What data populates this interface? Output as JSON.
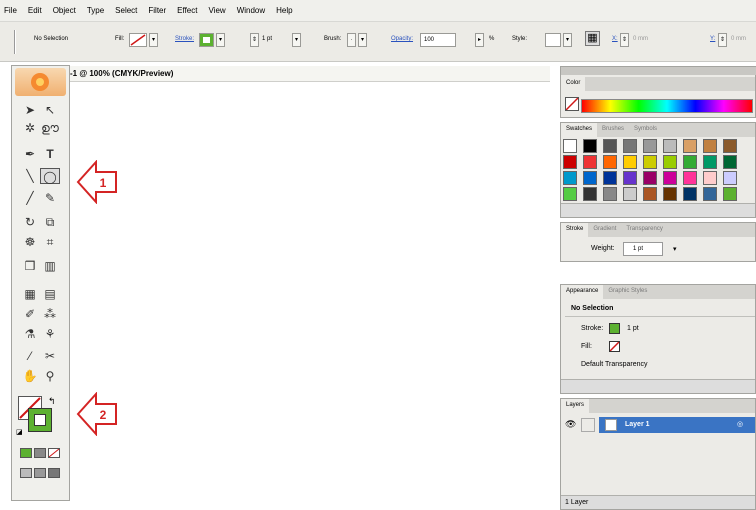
{
  "menu": [
    "File",
    "Edit",
    "Object",
    "Type",
    "Select",
    "Filter",
    "Effect",
    "View",
    "Window",
    "Help"
  ],
  "control_bar": {
    "selection": "No Selection",
    "fill_label": "Fill:",
    "stroke_label": "Stroke:",
    "stroke_weight": "1 pt",
    "brush_label": "Brush:",
    "opacity_label": "Opacity:",
    "opacity_value": "100",
    "opacity_unit": "%",
    "style_label": "Style:",
    "x_label": "X:",
    "x_value": "0 mm",
    "y_label": "Y:",
    "y_value": "0 mm"
  },
  "document": {
    "tab_title": "-1 @ 100% (CMYK/Preview)"
  },
  "callouts": {
    "one": "1",
    "two": "2"
  },
  "color_panel": {
    "title": "Color"
  },
  "swatches_panel": {
    "tabs": [
      "Swatches",
      "Brushes",
      "Symbols"
    ]
  },
  "stroke_panel": {
    "tabs": [
      "Stroke",
      "Gradient",
      "Transparency"
    ],
    "weight_label": "Weight:",
    "weight_value": "1 pt"
  },
  "appearance_panel": {
    "tabs": [
      "Appearance",
      "Graphic Styles"
    ],
    "header": "No Selection",
    "stroke_label": "Stroke:",
    "stroke_value": "1 pt",
    "fill_label": "Fill:",
    "default_transparency": "Default Transparency"
  },
  "layers_panel": {
    "tab": "Layers",
    "layer_name": "Layer 1",
    "footer_count": "1 Layer"
  },
  "colors": {
    "accent_blue": "#3a74c4",
    "stroke_green": "#5cb130",
    "none_red": "#d01818",
    "callout_red": "#d42424"
  }
}
